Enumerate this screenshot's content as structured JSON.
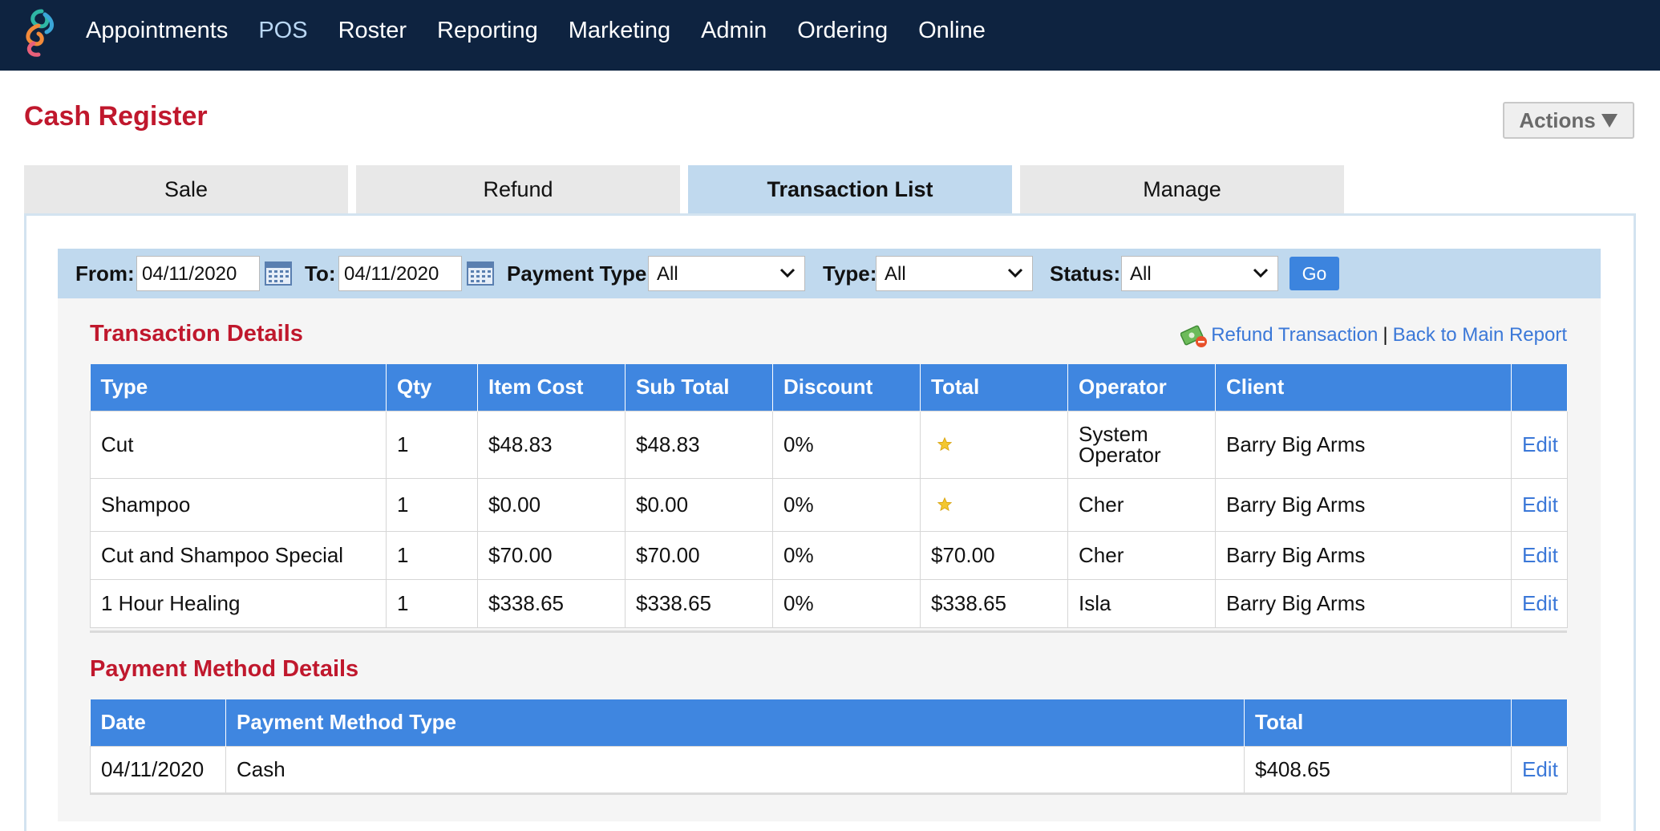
{
  "nav": {
    "items": [
      {
        "label": "Appointments"
      },
      {
        "label": "POS",
        "active": true
      },
      {
        "label": "Roster"
      },
      {
        "label": "Reporting"
      },
      {
        "label": "Marketing"
      },
      {
        "label": "Admin"
      },
      {
        "label": "Ordering"
      },
      {
        "label": "Online"
      }
    ]
  },
  "page": {
    "title": "Cash Register",
    "actions_label": "Actions"
  },
  "tabs": [
    {
      "label": "Sale"
    },
    {
      "label": "Refund"
    },
    {
      "label": "Transaction List",
      "active": true
    },
    {
      "label": "Manage"
    }
  ],
  "filters": {
    "from_label": "From:",
    "from_value": "04/11/2020",
    "to_label": "To:",
    "to_value": "04/11/2020",
    "payment_type_label": "Payment Type:",
    "payment_type_value": "All",
    "type_label": "Type:",
    "type_value": "All",
    "status_label": "Status:",
    "status_value": "All",
    "go_label": "Go"
  },
  "transaction_details": {
    "title": "Transaction Details",
    "refund_link": "Refund Transaction",
    "separator": "|",
    "back_link": "Back to Main Report",
    "columns": [
      "Type",
      "Qty",
      "Item Cost",
      "Sub Total",
      "Discount",
      "Total",
      "Operator",
      "Client",
      ""
    ],
    "rows": [
      {
        "type": "Cut",
        "qty": "1",
        "item_cost": "$48.83",
        "sub_total": "$48.83",
        "discount": "0%",
        "total": "",
        "total_star": true,
        "operator_line1": "System",
        "operator_line2": "Operator",
        "client": "Barry Big Arms",
        "edit": "Edit"
      },
      {
        "type": "Shampoo",
        "qty": "1",
        "item_cost": "$0.00",
        "sub_total": "$0.00",
        "discount": "0%",
        "total": "",
        "total_star": true,
        "operator": "Cher",
        "client": "Barry Big Arms",
        "edit": "Edit"
      },
      {
        "type": "Cut and Shampoo Special",
        "qty": "1",
        "item_cost": "$70.00",
        "sub_total": "$70.00",
        "discount": "0%",
        "total": "$70.00",
        "total_star": false,
        "operator": "Cher",
        "client": "Barry Big Arms",
        "edit": "Edit"
      },
      {
        "type": "1 Hour Healing",
        "qty": "1",
        "item_cost": "$338.65",
        "sub_total": "$338.65",
        "discount": "0%",
        "total": "$338.65",
        "total_star": false,
        "operator": "Isla",
        "client": "Barry Big Arms",
        "edit": "Edit"
      }
    ]
  },
  "payment_details": {
    "title": "Payment Method Details",
    "columns": [
      "Date",
      "Payment Method Type",
      "Total",
      ""
    ],
    "rows": [
      {
        "date": "04/11/2020",
        "method": "Cash",
        "total": "$408.65",
        "edit": "Edit"
      }
    ]
  },
  "colors": {
    "nav_bg": "#0e2340",
    "accent_red": "#c0182d",
    "header_blue": "#3f86e0",
    "link_blue": "#3b78d8",
    "tab_active": "#c0d9ee"
  },
  "icons": {
    "logo": "swirl-logo-icon",
    "calendar": "calendar-icon",
    "refund": "refund-money-icon",
    "star": "star-icon",
    "dropdown": "chevron-down-icon",
    "actions": "triangle-down-icon"
  }
}
